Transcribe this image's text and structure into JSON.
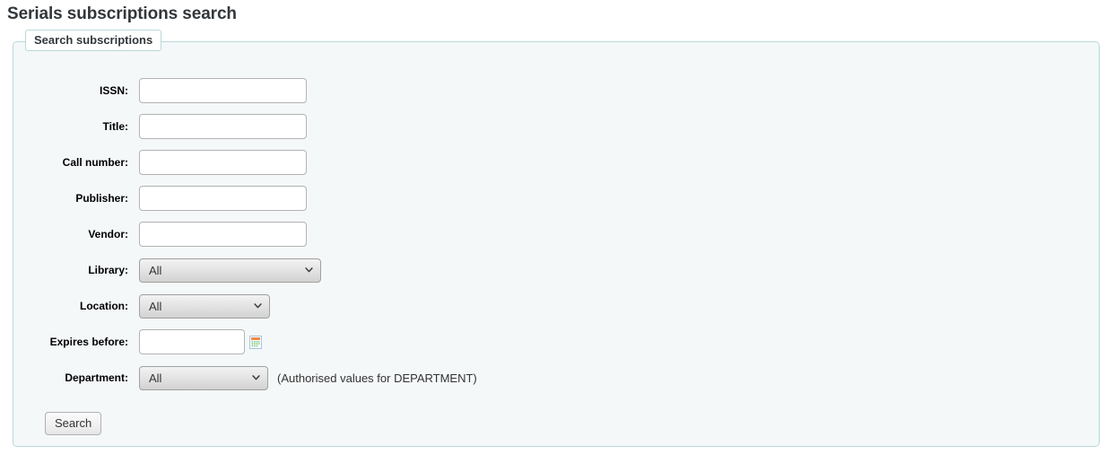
{
  "page": {
    "title": "Serials subscriptions search"
  },
  "fieldset": {
    "legend": "Search subscriptions"
  },
  "form": {
    "fields": [
      {
        "label": "ISSN:",
        "type": "text",
        "value": "",
        "placeholder": ""
      },
      {
        "label": "Title:",
        "type": "text",
        "value": "",
        "placeholder": ""
      },
      {
        "label": "Call number:",
        "type": "text",
        "value": "",
        "placeholder": ""
      },
      {
        "label": "Publisher:",
        "type": "text",
        "value": "",
        "placeholder": ""
      },
      {
        "label": "Vendor:",
        "type": "text",
        "value": "",
        "placeholder": ""
      },
      {
        "label": "Library:",
        "type": "select",
        "value": "All"
      },
      {
        "label": "Location:",
        "type": "select",
        "value": "All"
      },
      {
        "label": "Expires before:",
        "type": "date",
        "value": "",
        "placeholder": "",
        "icon": "calendar-icon"
      },
      {
        "label": "Department:",
        "type": "select",
        "value": "All",
        "hint": "(Authorised values for DEPARTMENT)"
      }
    ]
  },
  "actions": {
    "search_label": "Search"
  },
  "colors": {
    "fieldset_border": "#b9d8d9",
    "fieldset_background": "#f4f8f9",
    "heading": "#32373b",
    "calendar_header": "#f0884b",
    "calendar_frame": "#a8c5e0",
    "calendar_day": "#7cc47c"
  }
}
